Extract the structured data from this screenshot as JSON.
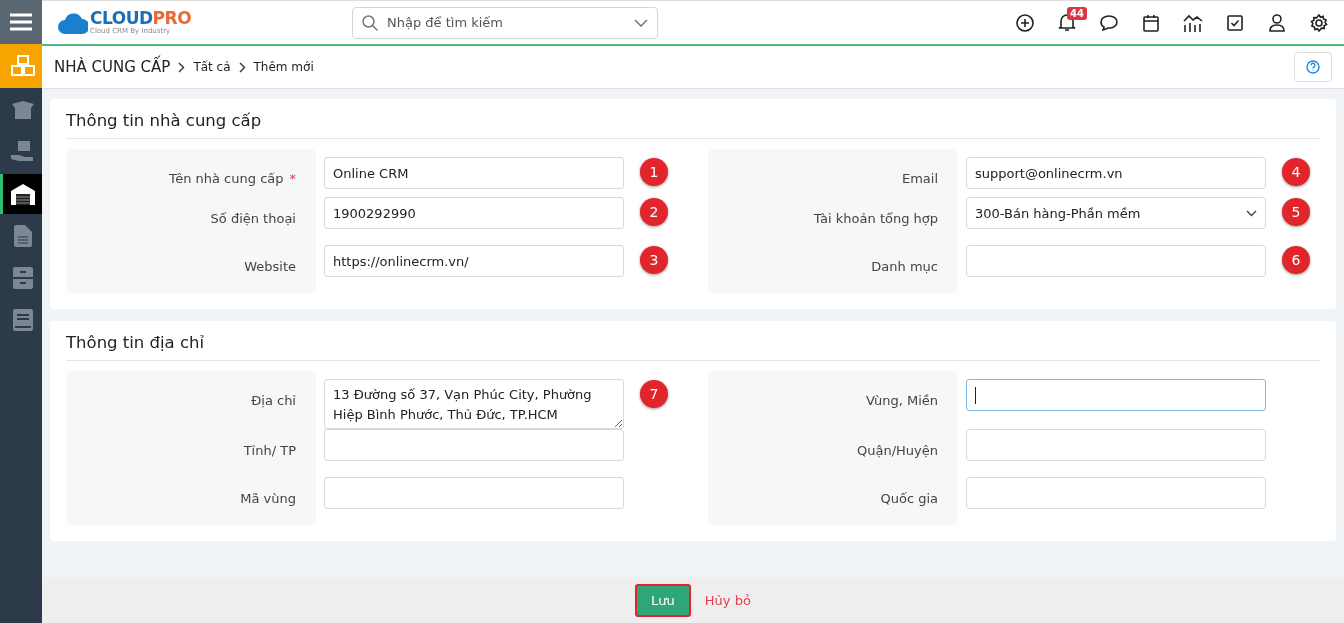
{
  "logo": {
    "brand_a": "CLOUD",
    "brand_b": "PRO",
    "tagline": "Cloud CRM By Industry"
  },
  "search": {
    "placeholder": "Nhập để tìm kiếm"
  },
  "toolbar": [
    {
      "kind": "add"
    },
    {
      "kind": "bell",
      "badge": "44"
    },
    {
      "kind": "chat"
    },
    {
      "kind": "calendar"
    },
    {
      "kind": "chart"
    },
    {
      "kind": "task"
    },
    {
      "kind": "user"
    },
    {
      "kind": "settings"
    }
  ],
  "sidebar": {
    "items": [
      {
        "kind": "cubes",
        "selected": false
      },
      {
        "kind": "box",
        "selected": false
      },
      {
        "kind": "hand",
        "selected": false
      },
      {
        "kind": "warehouse",
        "selected": true
      },
      {
        "kind": "document",
        "selected": false
      },
      {
        "kind": "cabinet",
        "selected": false
      },
      {
        "kind": "book",
        "selected": false
      }
    ]
  },
  "breadcrumb": [
    "NHÀ CUNG CẤP",
    "Tất cả",
    "Thêm mới"
  ],
  "sections": [
    {
      "title": "Thông tin nhà cung cấp",
      "rows": [
        [
          {
            "label": "Tên nhà cung cấp",
            "required_mark": "*",
            "kind": "text",
            "value": "Online CRM",
            "marker": "1",
            "focused": false
          },
          {
            "label": "Email",
            "kind": "text",
            "value": "support@onlinecrm.vn",
            "marker": "4",
            "focused": false
          }
        ],
        [
          {
            "label": "Số điện thoại",
            "kind": "text",
            "value": "1900292990",
            "marker": "2",
            "focused": false
          },
          {
            "label": "Tài khoản tổng hợp",
            "kind": "select",
            "value": "300-Bán hàng-Phần mềm",
            "marker": "5",
            "focused": false
          }
        ],
        [
          {
            "label": "Website",
            "kind": "text",
            "value": "https://onlinecrm.vn/",
            "marker": "3",
            "focused": false
          },
          {
            "label": "Danh mục",
            "kind": "text",
            "marker": "6",
            "focused": false
          }
        ]
      ]
    },
    {
      "title": "Thông tin địa chỉ",
      "rows": [
        [
          {
            "label": "Địa chỉ",
            "kind": "textarea",
            "value": "13 Đường số 37, Vạn Phúc City, Phường Hiệp Bình Phước, Thủ Đức, TP.HCM",
            "marker": "7",
            "focused": false
          },
          {
            "label": "Vùng, Miền",
            "kind": "text",
            "focused": true
          }
        ],
        [
          {
            "label": "Tỉnh/ TP",
            "kind": "text",
            "focused": false
          },
          {
            "label": "Quận/Huyện",
            "kind": "text",
            "focused": false
          }
        ],
        [
          {
            "label": "Mã vùng",
            "kind": "text",
            "focused": false
          },
          {
            "label": "Quốc gia",
            "kind": "text",
            "focused": false
          }
        ]
      ]
    }
  ],
  "footer": {
    "save": {
      "label": "Lưu",
      "highlighted": true
    },
    "cancel": {
      "label": "Hủy bỏ"
    }
  }
}
